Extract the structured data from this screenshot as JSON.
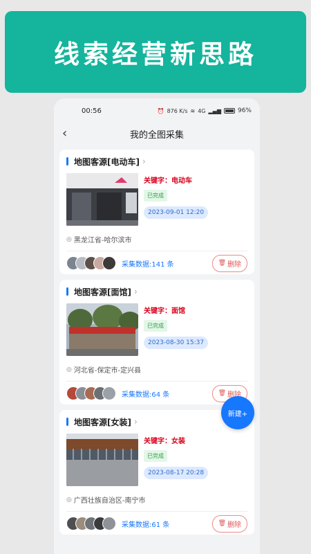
{
  "banner": {
    "title": "线索经营新思路"
  },
  "status_bar": {
    "time": "00:56",
    "net_speed": "876 K/s",
    "signal": "4G",
    "battery": "96%"
  },
  "nav": {
    "title": "我的全图采集"
  },
  "cards": [
    {
      "title": "地图客源[电动车]",
      "keyword_label": "关键字：",
      "keyword": "电动车",
      "status": "已完成",
      "time": "2023-09-01 12:20",
      "location": "黑龙江省-哈尔滨市",
      "count_label": "采集数据:",
      "count": "141",
      "count_unit": "条",
      "delete_label": "删除"
    },
    {
      "title": "地图客源[面馆]",
      "keyword_label": "关键字：",
      "keyword": "面馆",
      "status": "已完成",
      "time": "2023-08-30 15:37",
      "location": "河北省-保定市-定兴县",
      "count_label": "采集数据:",
      "count": "64",
      "count_unit": "条",
      "delete_label": "删除"
    },
    {
      "title": "地图客源[女装]",
      "keyword_label": "关键字：",
      "keyword": "女装",
      "status": "已完成",
      "time": "2023-08-17 20:28",
      "location": "广西壮族自治区-南宁市",
      "count_label": "采集数据:",
      "count": "61",
      "count_unit": "条",
      "delete_label": "删除"
    }
  ],
  "fab": {
    "label": "新建+"
  },
  "colors": {
    "accent": "#14b49d",
    "primary": "#1677ff",
    "danger": "#e25555",
    "keyword": "#d9001b"
  }
}
